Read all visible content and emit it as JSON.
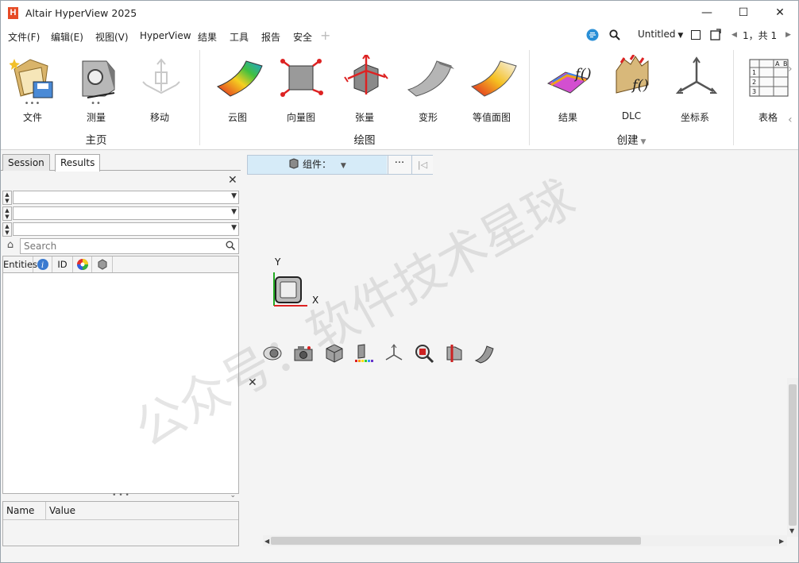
{
  "window": {
    "title": "Altair HyperView 2025",
    "logo_letter": "H",
    "minimize": "—",
    "maximize": "☐",
    "close": "✕"
  },
  "menubar": {
    "items": [
      "文件(F)",
      "编辑(E)",
      "视图(V)",
      "HyperView",
      "结果",
      "工具",
      "报告",
      "安全"
    ],
    "active_index": 4,
    "add": "+",
    "session_name": "Untitled",
    "page_info": "1，共 1"
  },
  "ribbon": {
    "buttons": [
      {
        "label": "文件",
        "icon": "file-folder-icon"
      },
      {
        "label": "测量",
        "icon": "measure-nut-icon"
      },
      {
        "label": "移动",
        "icon": "move-arrows-icon"
      },
      {
        "label": "云图",
        "icon": "contour-plot-icon"
      },
      {
        "label": "向量图",
        "icon": "vector-plot-icon"
      },
      {
        "label": "张量",
        "icon": "tensor-plot-icon"
      },
      {
        "label": "变形",
        "icon": "deformed-shape-icon"
      },
      {
        "label": "等值面图",
        "icon": "iso-surface-icon"
      },
      {
        "label": "结果",
        "icon": "results-math-icon"
      },
      {
        "label": "DLC",
        "icon": "dlc-icon"
      },
      {
        "label": "坐标系",
        "icon": "coordinate-system-icon"
      },
      {
        "label": "表格",
        "icon": "table-icon"
      }
    ],
    "groups": [
      "主页",
      "绘图",
      "创建"
    ]
  },
  "left_panel": {
    "tabs": [
      "Session",
      "Results"
    ],
    "active_tab": "Results",
    "search_placeholder": "Search",
    "columns": [
      "Entities",
      "ID"
    ],
    "props_columns": [
      "Name",
      "Value"
    ]
  },
  "viewport": {
    "component_label": "组件：",
    "more": "···",
    "first": "|◁",
    "axis_y": "Y",
    "axis_x": "X",
    "tools": [
      "visibility-eye-icon",
      "camera-icon",
      "cube-view-icon",
      "legend-icon",
      "triad-icon",
      "zoom-icon",
      "section-cut-icon",
      "mesh-curve-icon"
    ]
  },
  "watermark": "公众号：软件技术星球",
  "colors": {
    "accent": "#3a7bd5",
    "brand": "#e64b26",
    "component_bg": "#d6ebf8"
  }
}
